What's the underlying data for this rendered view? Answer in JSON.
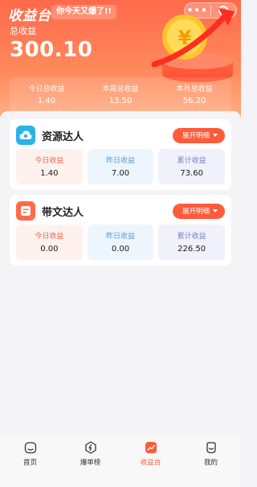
{
  "header": {
    "app_title": "收益台",
    "slogan": "你今天又爆了!!",
    "capsule_more": "•••"
  },
  "summary": {
    "total_label": "总收益",
    "total_value": "300.10",
    "stats": [
      {
        "label": "今日总收益",
        "value": "1.40"
      },
      {
        "label": "本周总收益",
        "value": "13.50"
      },
      {
        "label": "本月总收益",
        "value": "56.20"
      }
    ]
  },
  "cards": [
    {
      "name": "资源达人",
      "expand_label": "展开明细",
      "today_label": "今日收益",
      "today_value": "1.40",
      "yesterday_label": "昨日收益",
      "yesterday_value": "7.00",
      "cumulative_label": "累计收益",
      "cumulative_value": "73.60"
    },
    {
      "name": "带文达人",
      "expand_label": "展开明细",
      "today_label": "今日收益",
      "today_value": "0.00",
      "yesterday_label": "昨日收益",
      "yesterday_value": "0.00",
      "cumulative_label": "累计收益",
      "cumulative_value": "226.50"
    }
  ],
  "tabbar": {
    "items": [
      {
        "label": "首页",
        "icon": "home-icon"
      },
      {
        "label": "爆单榜",
        "icon": "lightning-icon"
      },
      {
        "label": "收益台",
        "icon": "chart-icon",
        "active": true
      },
      {
        "label": "我的",
        "icon": "smile-icon"
      }
    ]
  },
  "colors": {
    "accent": "#ff5b3a",
    "hero_top": "#ff6a4b",
    "hero_bottom": "#ffb089",
    "resource_logo": "#2bb3e8",
    "writer_logo": "#ff6b4a"
  }
}
